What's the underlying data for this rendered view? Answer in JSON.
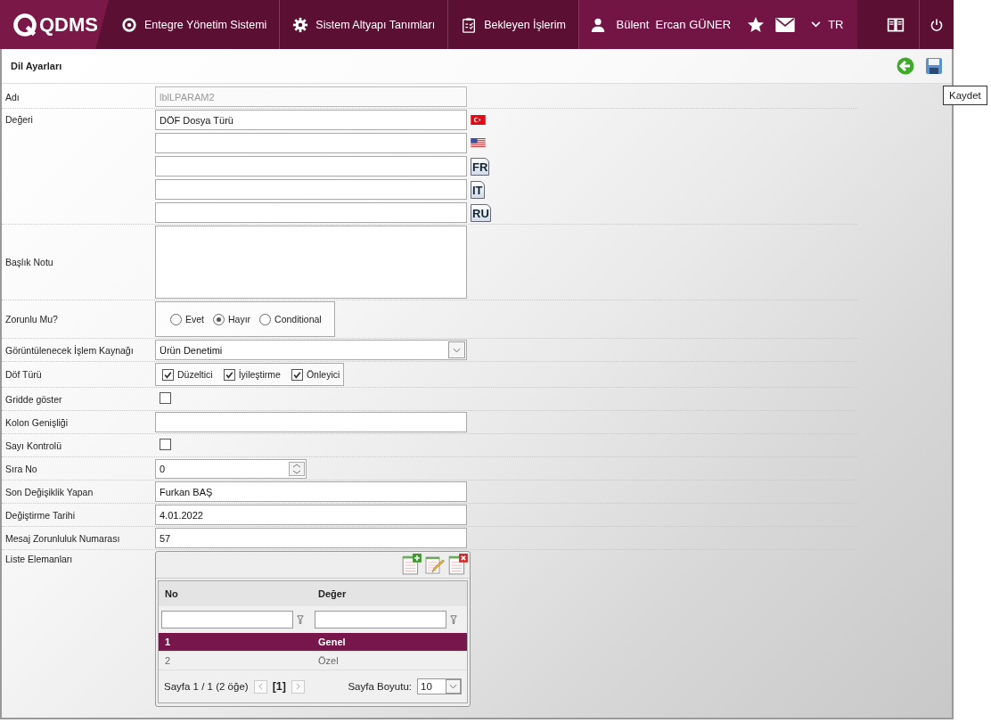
{
  "header": {
    "logo": "QDMS",
    "nav": [
      {
        "kind": "q",
        "label": "Entegre Yönetim Sistemi"
      },
      {
        "kind": "gear",
        "label": "Sistem Altyapı Tanımları"
      },
      {
        "kind": "clipboard",
        "label": "Bekleyen İşlerim"
      }
    ],
    "user": "Bülent  Ercan GÜNER",
    "language": "TR"
  },
  "page": {
    "title": "Dil Ayarları",
    "tooltip": "Kaydet"
  },
  "form": [
    {
      "kind": "text",
      "label": "Adı",
      "value": "lblLPARAM2",
      "disabled": true
    },
    {
      "kind": "multilang",
      "label": "Değeri",
      "entries": [
        {
          "kind": "tr-flag",
          "value": "DÖF Dosya Türü"
        },
        {
          "kind": "us-flag"
        },
        {
          "kind": "code",
          "code": "FR"
        },
        {
          "kind": "code",
          "code": "IT"
        },
        {
          "kind": "code",
          "code": "RU"
        }
      ]
    },
    {
      "kind": "textarea",
      "label": "Başlık Notu"
    },
    {
      "kind": "radio",
      "label": "Zorunlu Mu?",
      "options": [
        {
          "label": "Evet",
          "selected": false
        },
        {
          "label": "Hayır",
          "selected": true
        },
        {
          "label": "Conditional",
          "selected": false
        }
      ]
    },
    {
      "kind": "select",
      "label": "Görüntülenecek İşlem Kaynağı",
      "value": "Ürün Denetimi"
    },
    {
      "kind": "checkgroup",
      "label": "Döf Türü",
      "options": [
        {
          "label": "Düzeltici",
          "checked": true
        },
        {
          "label": "İyileştirme",
          "checked": true
        },
        {
          "label": "Önleyici",
          "checked": true
        }
      ]
    },
    {
      "kind": "checkbox",
      "label": "Gridde göster",
      "checked": false
    },
    {
      "kind": "text",
      "label": "Kolon Genişliği",
      "disabled": false
    },
    {
      "kind": "checkbox",
      "label": "Sayı Kontrolü",
      "checked": false
    },
    {
      "kind": "spinner",
      "label": "Sıra No",
      "value": "0"
    },
    {
      "kind": "text",
      "label": "Son Değişiklik Yapan",
      "value": "Furkan BAŞ",
      "disabled": false
    },
    {
      "kind": "text",
      "label": "Değiştirme Tarihi",
      "value": "4.01.2022",
      "disabled": false
    },
    {
      "kind": "text",
      "label": "Mesaj Zorunluluk Numarası",
      "value": "57",
      "disabled": false
    },
    {
      "kind": "grid",
      "label": "Liste Elemanları",
      "columns": [
        "No",
        "Değer"
      ],
      "rows": [
        {
          "cells": [
            "1",
            "Genel"
          ],
          "selected": true
        },
        {
          "cells": [
            "2",
            "Özel"
          ],
          "selected": false
        }
      ],
      "pager": {
        "summary": "Sayfa 1 / 1 (2 öğe)",
        "current": "[1]",
        "size_label": "Sayfa Boyutu:",
        "size": "10"
      }
    }
  ]
}
